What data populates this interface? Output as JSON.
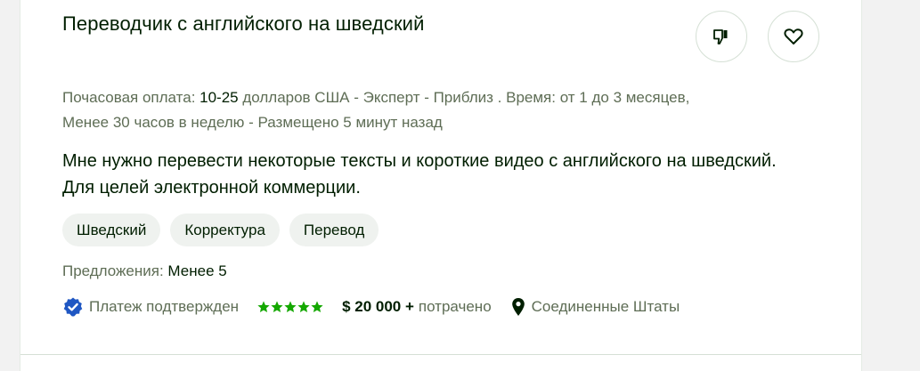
{
  "job": {
    "title": "Переводчик с английского на шведский",
    "meta": {
      "rate_label": "Почасовая оплата: ",
      "rate_value": "10-25",
      "rest_line1": " долларов США - Эксперт - Приблиз . Время: от 1 до 3 месяцев,",
      "line2": "Менее 30 часов в неделю - Размещено 5 минут назад"
    },
    "description": "Мне нужно перевести некоторые тексты и короткие видео с английского на шведский. Для целей электронной коммерции.",
    "tags": [
      "Шведский",
      "Корректура",
      "Перевод"
    ],
    "proposals": {
      "label": "Предложения: ",
      "value": "Менее 5"
    },
    "client": {
      "payment_verified": "Платеж подтвержден",
      "rating": 5,
      "spent_amount": "$ 20 000 +",
      "spent_label": "потрачено",
      "location": "Соединенные Штаты"
    },
    "icons": {
      "dislike": "thumbs-down-icon",
      "like": "heart-icon",
      "verified": "verified-badge-icon",
      "star": "star-icon",
      "location": "location-pin-icon"
    },
    "colors": {
      "verified": "#1f57c3",
      "stars": "#14a800",
      "text": "#001e00",
      "muted": "#5e6d55",
      "tag_bg": "#eff2ef"
    }
  }
}
